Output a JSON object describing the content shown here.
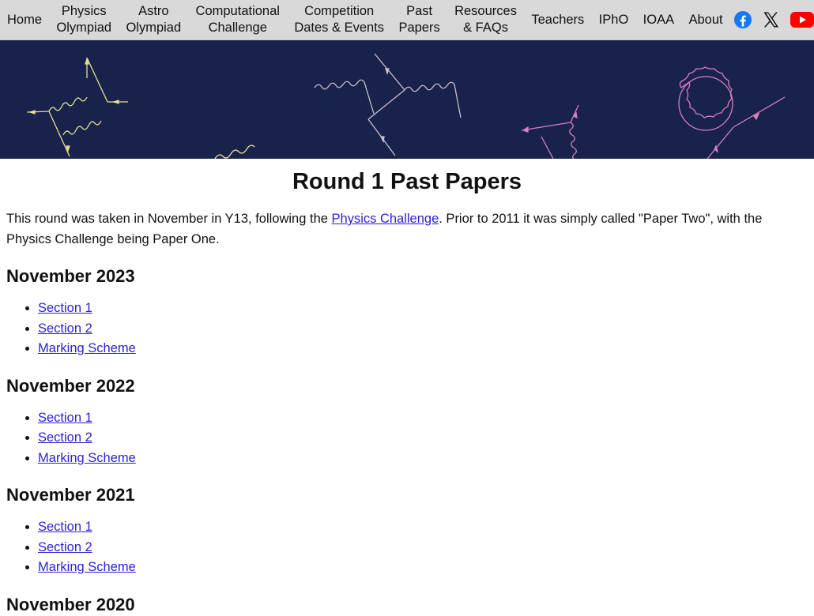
{
  "nav": {
    "items": [
      {
        "line1": "Home",
        "line2": ""
      },
      {
        "line1": "Physics",
        "line2": "Olympiad"
      },
      {
        "line1": "Astro",
        "line2": "Olympiad"
      },
      {
        "line1": "Computational",
        "line2": "Challenge"
      },
      {
        "line1": "Competition",
        "line2": "Dates & Events"
      },
      {
        "line1": "Past",
        "line2": "Papers"
      },
      {
        "line1": "Resources",
        "line2": "& FAQs"
      },
      {
        "line1": "Teachers",
        "line2": ""
      },
      {
        "line1": "IPhO",
        "line2": ""
      },
      {
        "line1": "IOAA",
        "line2": ""
      },
      {
        "line1": "About",
        "line2": ""
      }
    ],
    "social_icons": [
      "facebook-icon",
      "x-icon",
      "youtube-icon"
    ],
    "colors": {
      "bar": "#d9d9d9",
      "facebook": "#1877f2",
      "youtube": "#ff0000"
    }
  },
  "banner": {
    "background": "#18224a",
    "diagram_colors": [
      "#e4e08f",
      "#cbbfd0",
      "#d97fc0"
    ]
  },
  "page": {
    "title": "Round 1 Past Papers",
    "intro_before": "This round was taken in November in Y13, following the ",
    "intro_link": "Physics Challenge",
    "intro_after": ". Prior to 2011 it was simply called \"Paper Two\", with the Physics Challenge being Paper One."
  },
  "sections": [
    {
      "heading": "November 2023",
      "links": [
        "Section 1",
        "Section 2",
        "Marking Scheme"
      ]
    },
    {
      "heading": "November 2022",
      "links": [
        "Section 1",
        "Section 2",
        "Marking Scheme"
      ]
    },
    {
      "heading": "November 2021",
      "links": [
        "Section 1",
        "Section 2",
        "Marking Scheme"
      ]
    },
    {
      "heading": "November 2020",
      "links": []
    }
  ],
  "link_color": "#2a1fd6"
}
